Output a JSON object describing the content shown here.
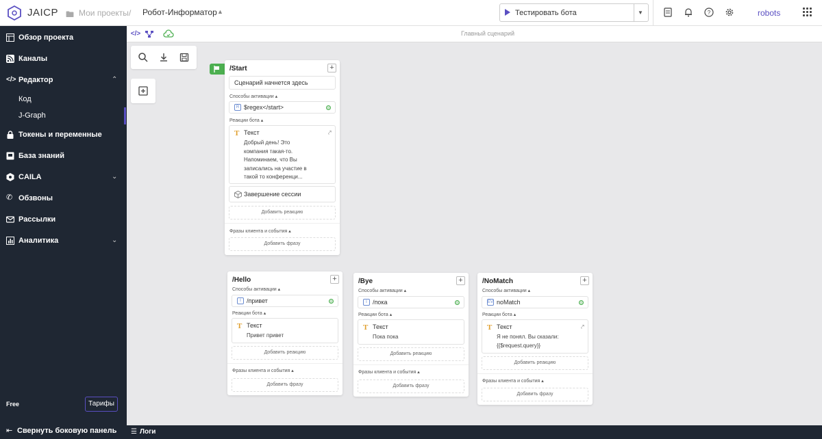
{
  "header": {
    "brand": "JAICP",
    "breadcrumb_root": "Мои проекты",
    "breadcrumb_sep": "/",
    "project": "Робот-Информатор",
    "test_button": "Тестировать бота",
    "user": "robots"
  },
  "sidebar": {
    "items": [
      {
        "label": "Обзор проекта"
      },
      {
        "label": "Каналы"
      },
      {
        "label": "Редактор"
      },
      {
        "label": "Токены и переменные"
      },
      {
        "label": "База знаний"
      },
      {
        "label": "CAILA"
      },
      {
        "label": "Обзвоны"
      },
      {
        "label": "Рассылки"
      },
      {
        "label": "Аналитика"
      }
    ],
    "sub_items": [
      {
        "label": "Код"
      },
      {
        "label": "J-Graph"
      }
    ],
    "plan": "Free",
    "plan_button": "Тарифы",
    "collapse": "Свернуть боковую панель"
  },
  "toolbar": {
    "caption": "Главный сценарий"
  },
  "bottom": {
    "logs": "Логи"
  },
  "labels": {
    "activation": "Способы активации",
    "reactions": "Реакции бота",
    "add_reaction": "Добавить реакцию",
    "phrases": "Фразы клиента и события",
    "add_phrase": "Добавить фразу",
    "text": "Текст"
  },
  "cards": {
    "start": {
      "title": "/Start",
      "intro": "Сценарий начнется здесь",
      "activation": "$regex</start>",
      "text_lines": [
        "Добрый день! Это",
        "компания такая-то.",
        "Напоминаем, что Вы",
        "записались на участие в",
        "такой то конференци..."
      ],
      "end_session": "Завершение сессии"
    },
    "hello": {
      "title": "/Hello",
      "activation": "/привет",
      "text": "Привет привет"
    },
    "bye": {
      "title": "/Bye",
      "activation": "/пока",
      "text": "Пока пока"
    },
    "nomatch": {
      "title": "/NoMatch",
      "activation": "noMatch",
      "text_lines": [
        "Я не понял. Вы сказали:",
        "{{$request.query}}"
      ]
    }
  },
  "colors": {
    "accent": "#5a4fc2",
    "sidebar_bg": "#1f2733",
    "start_flag": "#4caf50",
    "text_icon": "#e0a030"
  }
}
